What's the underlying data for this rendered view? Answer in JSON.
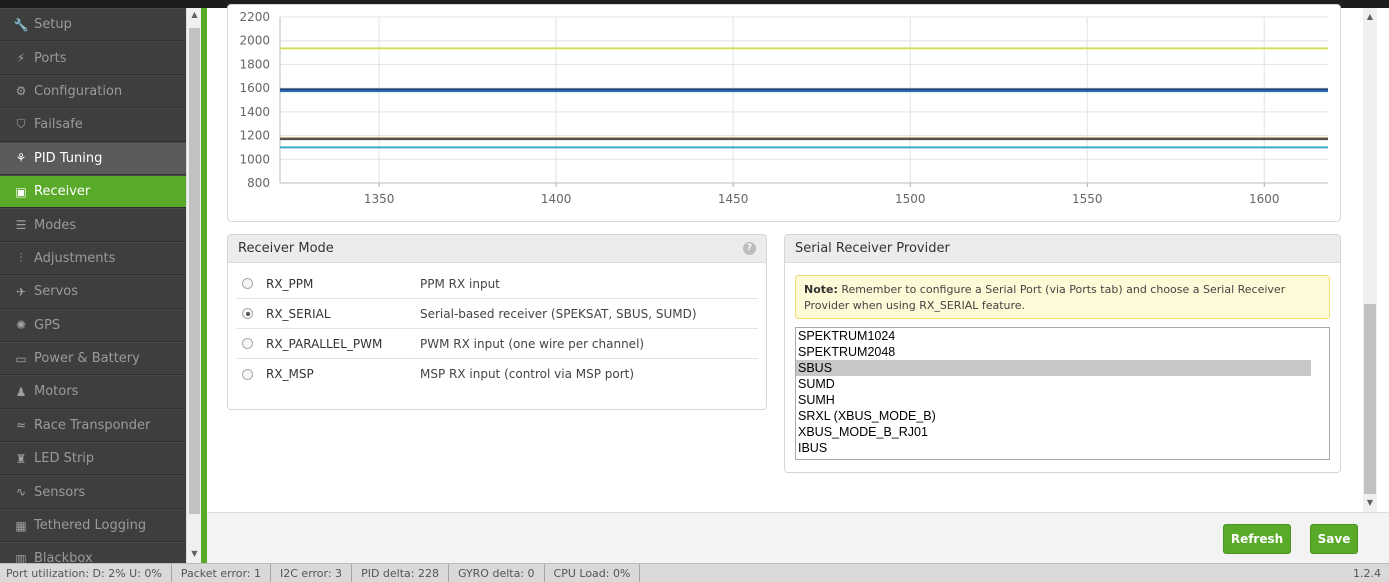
{
  "sidebar": {
    "items": [
      {
        "label": "Setup",
        "icon": "wrench-icon",
        "glyph": "🔧",
        "state": ""
      },
      {
        "label": "Ports",
        "icon": "plug-icon",
        "glyph": "⚡",
        "state": ""
      },
      {
        "label": "Configuration",
        "icon": "gear-icon",
        "glyph": "⚙",
        "state": ""
      },
      {
        "label": "Failsafe",
        "icon": "shield-icon",
        "glyph": "⛉",
        "state": ""
      },
      {
        "label": "PID Tuning",
        "icon": "sitemap-icon",
        "glyph": "⚘",
        "state": "dark"
      },
      {
        "label": "Receiver",
        "icon": "receiver-icon",
        "glyph": "▣",
        "state": "green"
      },
      {
        "label": "Modes",
        "icon": "toggles-icon",
        "glyph": "☰",
        "state": ""
      },
      {
        "label": "Adjustments",
        "icon": "sliders-icon",
        "glyph": "⫶",
        "state": ""
      },
      {
        "label": "Servos",
        "icon": "servo-icon",
        "glyph": "✈",
        "state": ""
      },
      {
        "label": "GPS",
        "icon": "satellite-icon",
        "glyph": "✺",
        "state": ""
      },
      {
        "label": "Power & Battery",
        "icon": "battery-icon",
        "glyph": "▭",
        "state": ""
      },
      {
        "label": "Motors",
        "icon": "motor-icon",
        "glyph": "♟",
        "state": ""
      },
      {
        "label": "Race Transponder",
        "icon": "transponder-icon",
        "glyph": "≈",
        "state": ""
      },
      {
        "label": "LED Strip",
        "icon": "led-icon",
        "glyph": "♜",
        "state": ""
      },
      {
        "label": "Sensors",
        "icon": "pulse-icon",
        "glyph": "∿",
        "state": ""
      },
      {
        "label": "Tethered Logging",
        "icon": "logging-icon",
        "glyph": "▦",
        "state": ""
      },
      {
        "label": "Blackbox",
        "icon": "blackbox-icon",
        "glyph": "▥",
        "state": ""
      }
    ]
  },
  "chart_data": {
    "type": "line",
    "title": "",
    "xlabel": "",
    "ylabel": "",
    "xlim": [
      1322,
      1618
    ],
    "ylim": [
      800,
      2200
    ],
    "x_ticks": [
      1350,
      1400,
      1450,
      1500,
      1550,
      1600
    ],
    "y_ticks": [
      800,
      1000,
      1200,
      1400,
      1600,
      1800,
      2000,
      2200
    ],
    "grid": true,
    "series": [
      {
        "color": "#d4e157",
        "x": [
          1322,
          1618
        ],
        "values": [
          1935,
          1935
        ]
      },
      {
        "color": "#1e3f7a",
        "x": [
          1322,
          1618
        ],
        "values": [
          1585,
          1585
        ]
      },
      {
        "color": "#2c6fb0",
        "x": [
          1322,
          1618
        ],
        "values": [
          1575,
          1575
        ]
      },
      {
        "color": "#c9a27a",
        "x": [
          1322,
          1618
        ],
        "values": [
          1180,
          1180
        ]
      },
      {
        "color": "#4d4d4d",
        "x": [
          1322,
          1618
        ],
        "values": [
          1170,
          1170
        ]
      },
      {
        "color": "#3fa9c9",
        "x": [
          1322,
          1618
        ],
        "values": [
          1100,
          1100
        ]
      }
    ]
  },
  "receiver_mode": {
    "title": "Receiver Mode",
    "help": "?",
    "options": [
      {
        "name": "RX_PPM",
        "desc": "PPM RX input",
        "checked": false
      },
      {
        "name": "RX_SERIAL",
        "desc": "Serial-based receiver (SPEKSAT, SBUS, SUMD)",
        "checked": true
      },
      {
        "name": "RX_PARALLEL_PWM",
        "desc": "PWM RX input (one wire per channel)",
        "checked": false
      },
      {
        "name": "RX_MSP",
        "desc": "MSP RX input (control via MSP port)",
        "checked": false
      }
    ]
  },
  "serial_provider": {
    "title": "Serial Receiver Provider",
    "note_label": "Note:",
    "note_text": " Remember to configure a Serial Port (via Ports tab) and choose a Serial Receiver Provider when using RX_SERIAL feature.",
    "options": [
      "SPEKTRUM1024",
      "SPEKTRUM2048",
      "SBUS",
      "SUMD",
      "SUMH",
      "SRXL (XBUS_MODE_B)",
      "XBUS_MODE_B_RJ01",
      "IBUS"
    ],
    "selected": "SBUS"
  },
  "toolbar": {
    "refresh_label": "Refresh",
    "save_label": "Save"
  },
  "status": {
    "port_utilization": "Port utilization: D: 2% U: 0%",
    "packet_error": "Packet error: 1",
    "i2c_error": "I2C error: 3",
    "pid_delta": "PID delta: 228",
    "gyro_delta": "GYRO delta: 0",
    "cpu_load": "CPU Load: 0%",
    "version": "1.2.4"
  }
}
